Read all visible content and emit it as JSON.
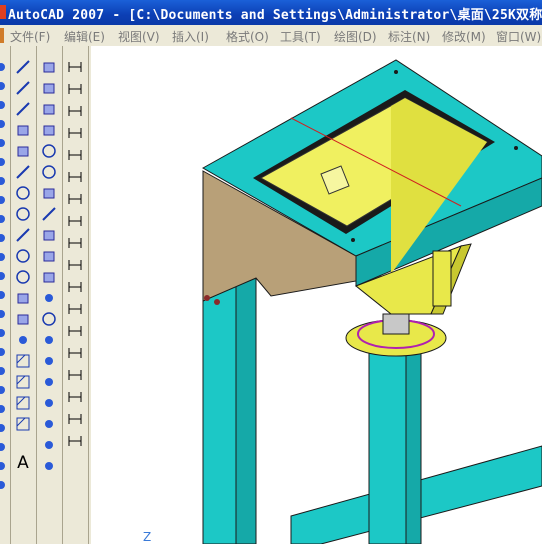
{
  "window": {
    "title": "AutoCAD 2007 - [C:\\Documents and Settings\\Administrator\\桌面\\25K双称"
  },
  "menu": [
    {
      "label": "文件(F)"
    },
    {
      "label": "编辑(E)"
    },
    {
      "label": "视图(V)"
    },
    {
      "label": "插入(I)"
    },
    {
      "label": "格式(O)"
    },
    {
      "label": "工具(T)"
    },
    {
      "label": "绘图(D)"
    },
    {
      "label": "标注(N)"
    },
    {
      "label": "修改(M)"
    },
    {
      "label": "窗口(W)"
    }
  ],
  "toolbars": {
    "left_edge_icons": [
      "move-icon",
      "rotate-icon",
      "scale-icon",
      "stretch-icon",
      "trim-icon",
      "extend-icon",
      "break-icon",
      "join-icon",
      "chamfer-icon",
      "fillet-icon",
      "explode-icon",
      "properties-icon",
      "layer-icon",
      "match-icon",
      "copy-icon",
      "mirror-icon",
      "offset-icon",
      "array-icon",
      "erase-icon",
      "undo-icon",
      "redo-icon",
      "pan-icon",
      "zoom-icon"
    ],
    "draw_tools": [
      "line-icon",
      "construction-line-icon",
      "polyline-icon",
      "polygon-icon",
      "rectangle-icon",
      "arc-icon",
      "circle-icon",
      "revision-cloud-icon",
      "spline-icon",
      "ellipse-icon",
      "ellipse-arc-icon",
      "insert-block-icon",
      "make-block-icon",
      "point-icon",
      "hatch-icon",
      "gradient-icon",
      "region-icon",
      "table-icon",
      "multiline-text-icon"
    ],
    "solids_tools": [
      "box-icon",
      "wedge-icon",
      "cone-icon",
      "cylinder-icon",
      "sphere-icon",
      "torus-icon",
      "pyramid-icon",
      "helix-icon",
      "polysolid-icon",
      "extrude-icon",
      "revolve-icon",
      "camera-icon",
      "orbit-icon",
      "view-icon",
      "walk-icon",
      "zoom-window-icon",
      "pan-realtime-icon",
      "light-icon",
      "render-icon",
      "footprint-icon"
    ],
    "dimension_tools": [
      "linear-dim-icon",
      "aligned-dim-icon",
      "arc-length-dim-icon",
      "ordinate-dim-icon",
      "radius-dim-icon",
      "jogged-dim-icon",
      "diameter-dim-icon",
      "angular-dim-icon",
      "quick-dim-icon",
      "baseline-dim-icon",
      "continue-dim-icon",
      "quick-leader-icon",
      "tolerance-icon",
      "center-mark-icon",
      "dim-edit-icon",
      "dim-text-edit-icon",
      "dim-update-icon",
      "dim-style-icon"
    ]
  },
  "drawing": {
    "colors": {
      "frame": "#1cc8c6",
      "frame_dark": "#159c9c",
      "hopper": "#e8e84a",
      "hopper_dark": "#b8b800",
      "plate": "#b8a078",
      "edge": "#1a1a1a"
    },
    "ucs_label": "Z"
  }
}
